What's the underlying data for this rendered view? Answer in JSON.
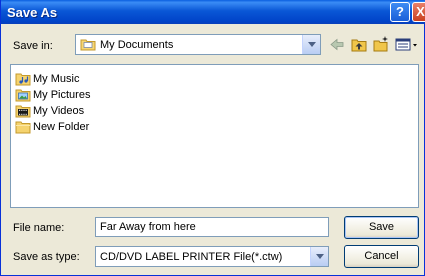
{
  "window": {
    "title": "Save As",
    "help_glyph": "?",
    "close_glyph": "X"
  },
  "toolbar": {
    "save_in_label": "Save in:",
    "save_in_value": "My Documents",
    "icons": [
      "back-arrow-icon",
      "up-folder-icon",
      "new-folder-icon",
      "views-menu-icon"
    ]
  },
  "files": [
    {
      "name": "My Music",
      "icon": "music-folder-icon"
    },
    {
      "name": "My Pictures",
      "icon": "pictures-folder-icon"
    },
    {
      "name": "My Videos",
      "icon": "videos-folder-icon"
    },
    {
      "name": "New Folder",
      "icon": "folder-icon"
    }
  ],
  "form": {
    "file_name_label": "File name:",
    "file_name_value": "Far Away from here",
    "save_as_type_label": "Save as type:",
    "save_as_type_value": "CD/DVD LABEL PRINTER File(*.ctw)",
    "save_button": "Save",
    "cancel_button": "Cancel"
  }
}
